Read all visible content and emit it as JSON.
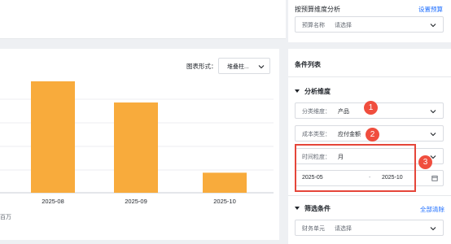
{
  "budget_filter": {
    "section_label": "按预算维度分析",
    "settings_link": "设置预算",
    "budget_name_label": "预算名称",
    "budget_name_placeholder": "请选择"
  },
  "chart_toolbar": {
    "form_label": "图表形式：",
    "form_value": "堆叠柱..."
  },
  "chart_data": {
    "type": "bar",
    "categories": [
      "2025-08",
      "2025-09",
      "2025-10"
    ],
    "values": [
      100,
      81,
      18
    ],
    "unit_label": "百万",
    "bar_color": "#f8ab3c",
    "grid": true
  },
  "conditions": {
    "title": "条件列表",
    "analysis": {
      "header": "分析维度",
      "category_label": "分类维度：",
      "category_value": "产品",
      "cost_type_label": "成本类型：",
      "cost_type_value": "应付金额",
      "granularity_label": "时间粒度：",
      "granularity_value": "月",
      "range_start": "2025-05",
      "range_sep": "-",
      "range_end": "2025-10"
    },
    "filters": {
      "header": "筛选条件",
      "clear_all": "全部清除",
      "finance_unit_label": "财务单元",
      "finance_unit_placeholder": "请选择"
    }
  },
  "annotations": [
    "1",
    "2",
    "3"
  ],
  "colors": {
    "accent": "#1f6fff",
    "annotation_red": "#f04e3e",
    "bar": "#f8ab3c"
  }
}
